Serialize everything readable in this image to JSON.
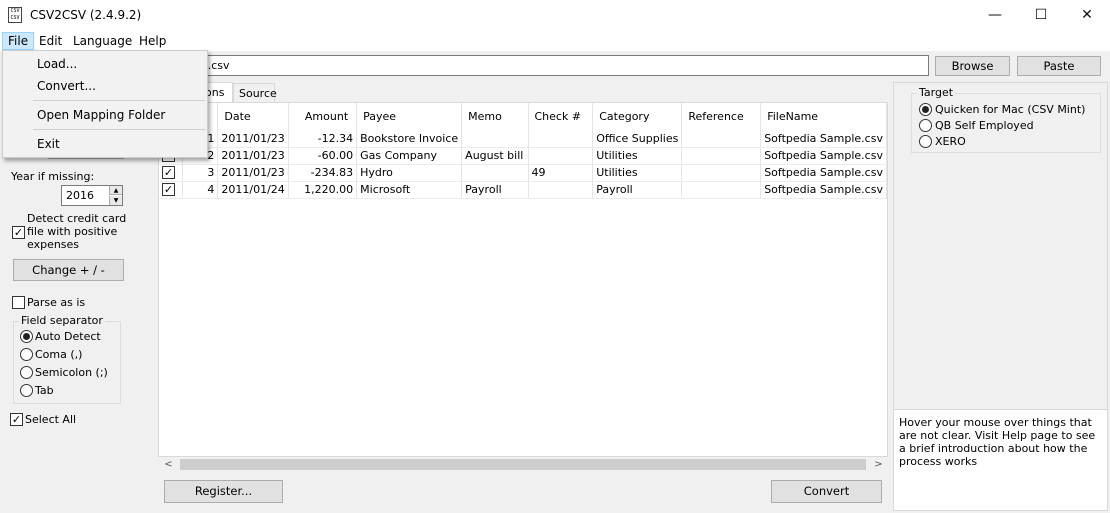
{
  "window": {
    "title": "CSV2CSV (2.4.9.2)",
    "icon_text": "CSV CSV",
    "controls": {
      "minimize": "—",
      "maximize": "☐",
      "close": "✕"
    }
  },
  "menubar": [
    "File",
    "Edit",
    "Language",
    "Help"
  ],
  "file_menu": {
    "items": [
      "Load...",
      "Convert...",
      "Open Mapping Folder",
      "Exit"
    ]
  },
  "topbar": {
    "file_value": "e.csv",
    "browse_label": "Browse",
    "paste_label": "Paste"
  },
  "left": {
    "year_label": "Year if missing:",
    "year_value": "2016",
    "detect_label": "Detect credit card file with positive expenses",
    "detect_checked": "✓",
    "change_button": "Change + / -",
    "parse_as_is": "Parse as is",
    "separator_group": "Field separator",
    "separators": [
      "Auto Detect",
      "Coma (,)",
      "Semicolon (;)",
      "Tab"
    ],
    "select_all": "Select All",
    "select_all_checked": "✓"
  },
  "tabs": [
    "ions",
    "Source"
  ],
  "grid": {
    "columns": [
      "",
      "Date",
      "Amount",
      "Payee",
      "Memo",
      "Check #",
      "Category",
      "Reference",
      "FileName"
    ],
    "rows": [
      {
        "checked": "",
        "num": "1",
        "date": "2011/01/23",
        "amount": "-12.34",
        "payee": "Bookstore Invoice",
        "memo": "",
        "check": "",
        "category": "Office Supplies",
        "reference": "",
        "filename": "Softpedia Sample.csv"
      },
      {
        "checked": "",
        "num": "2",
        "date": "2011/01/23",
        "amount": "-60.00",
        "payee": "Gas Company",
        "memo": "August bill",
        "check": "",
        "category": "Utilities",
        "reference": "",
        "filename": "Softpedia Sample.csv"
      },
      {
        "checked": "✓",
        "num": "3",
        "date": "2011/01/23",
        "amount": "-234.83",
        "payee": "Hydro",
        "memo": "",
        "check": "49",
        "category": "Utilities",
        "reference": "",
        "filename": "Softpedia Sample.csv"
      },
      {
        "checked": "✓",
        "num": "4",
        "date": "2011/01/24",
        "amount": "1,220.00",
        "payee": "Microsoft",
        "memo": "Payroll",
        "check": "",
        "category": "Payroll",
        "reference": "",
        "filename": "Softpedia Sample.csv"
      }
    ],
    "scroll_left": "<",
    "scroll_right": ">"
  },
  "bottom": {
    "register_label": "Register...",
    "convert_label": "Convert"
  },
  "target": {
    "legend": "Target",
    "options": [
      "Quicken for Mac (CSV Mint)",
      "QB Self Employed",
      "XERO"
    ],
    "selected": 0
  },
  "help_text": "Hover your mouse over things that are not clear. Visit Help page to see a brief introduction about how the process works"
}
